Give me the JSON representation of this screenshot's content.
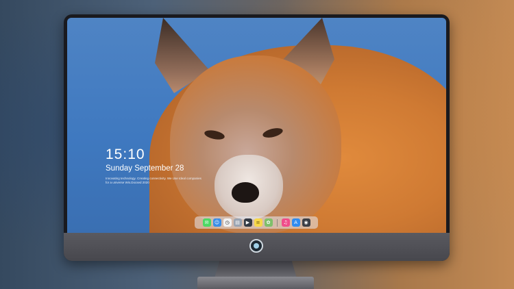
{
  "lockscreen": {
    "time": "15:10",
    "date": "Sunday September 28",
    "tagline": "Innovating technology. Creating connectivity. We Use Ideal companies for a universe Wis.Docsed 2020"
  },
  "dock": {
    "apps": [
      {
        "icon": "messages-icon",
        "glyph": "✉",
        "color": "#4cd964"
      },
      {
        "icon": "finder-icon",
        "glyph": "☺",
        "color": "#3b8ee8"
      },
      {
        "icon": "clock-icon",
        "glyph": "◷",
        "color": "#f2f2f2"
      },
      {
        "icon": "files-icon",
        "glyph": "▤",
        "color": "#9aa4b2"
      },
      {
        "icon": "clapper-icon",
        "glyph": "▶",
        "color": "#333a44"
      },
      {
        "icon": "notes-icon",
        "glyph": "≡",
        "color": "#f7d84a"
      },
      {
        "icon": "photos-icon",
        "glyph": "✿",
        "color": "#7fbf6a"
      }
    ],
    "apps_right": [
      {
        "icon": "music-icon",
        "glyph": "♫",
        "color": "#f04d8a"
      },
      {
        "icon": "app-store-icon",
        "glyph": "A",
        "color": "#2f8cf0"
      },
      {
        "icon": "camera-icon",
        "glyph": "◉",
        "color": "#3c3f46"
      }
    ]
  },
  "colors": {
    "screen_sky": "#3f79c0",
    "fox_orange": "#cf7a33",
    "bezel": "#1a1a1e",
    "chin": "#4f4f55"
  }
}
